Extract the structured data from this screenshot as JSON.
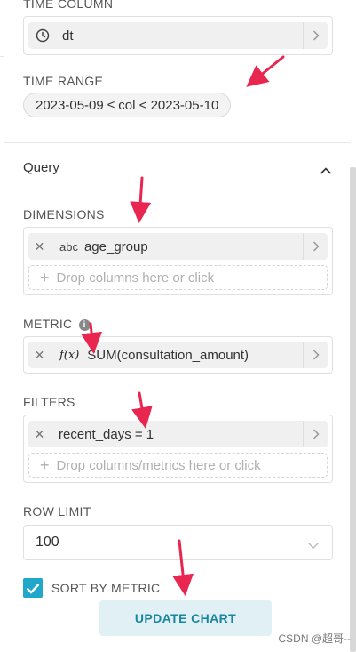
{
  "time_column": {
    "label": "TIME COLUMN",
    "value": "dt",
    "icon": "clock-icon"
  },
  "time_range": {
    "label": "TIME RANGE",
    "value": "2023-05-09 ≤ col < 2023-05-10"
  },
  "query_section": {
    "title": "Query",
    "collapse_icon": "chevron-up-icon"
  },
  "dimensions": {
    "label": "DIMENSIONS",
    "items": [
      {
        "type_tag": "abc",
        "value": "age_group"
      }
    ],
    "drop_placeholder": "Drop columns here or click"
  },
  "metric": {
    "label": "METRIC",
    "info_icon": "info-icon",
    "items": [
      {
        "type_tag": "f(x)",
        "value": "SUM(consultation_amount)"
      }
    ]
  },
  "filters": {
    "label": "FILTERS",
    "items": [
      {
        "value": "recent_days = 1"
      }
    ],
    "drop_placeholder": "Drop columns/metrics here or click"
  },
  "row_limit": {
    "label": "ROW LIMIT",
    "value": "100"
  },
  "sort_by_metric": {
    "label": "SORT BY METRIC",
    "checked": true
  },
  "update_chart": {
    "label": "UPDATE CHART"
  },
  "watermark": "CSDN @超哥--",
  "colors": {
    "accent": "#20a7c9",
    "button_text": "#1a85a0",
    "button_bg": "#e0f0f5",
    "annotation_arrow": "#e8264f"
  }
}
